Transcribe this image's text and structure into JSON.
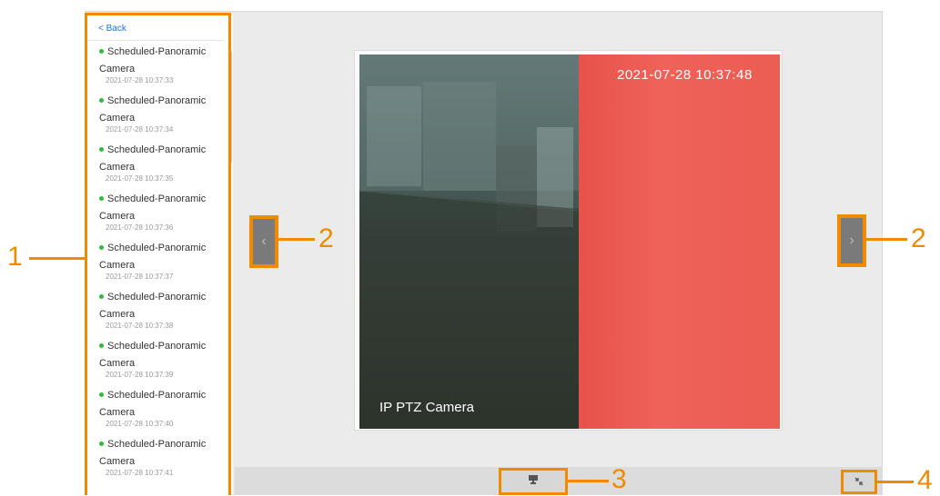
{
  "sidebar": {
    "back_label": "< Back",
    "items": [
      {
        "title": "Scheduled-Panoramic",
        "subtitle": "Camera",
        "time": "2021-07-28 10:37:33"
      },
      {
        "title": "Scheduled-Panoramic",
        "subtitle": "Camera",
        "time": "2021-07-28 10:37:34"
      },
      {
        "title": "Scheduled-Panoramic",
        "subtitle": "Camera",
        "time": "2021-07-28 10:37:35"
      },
      {
        "title": "Scheduled-Panoramic",
        "subtitle": "Camera",
        "time": "2021-07-28 10:37:36"
      },
      {
        "title": "Scheduled-Panoramic",
        "subtitle": "Camera",
        "time": "2021-07-28 10:37:37"
      },
      {
        "title": "Scheduled-Panoramic",
        "subtitle": "Camera",
        "time": "2021-07-28 10:37:38"
      },
      {
        "title": "Scheduled-Panoramic",
        "subtitle": "Camera",
        "time": "2021-07-28 10:37:39"
      },
      {
        "title": "Scheduled-Panoramic",
        "subtitle": "Camera",
        "time": "2021-07-28 10:37:40"
      },
      {
        "title": "Scheduled-Panoramic",
        "subtitle": "Camera",
        "time": "2021-07-28 10:37:41"
      }
    ],
    "status_color": "#2dbd3a"
  },
  "viewer": {
    "timestamp": "2021-07-28 10:37:48",
    "camera_label": "IP PTZ Camera",
    "prev_icon": "chevron-left-icon",
    "next_icon": "chevron-right-icon"
  },
  "toolbar": {
    "view_icon": "monitor-icon",
    "fullscreen_icon": "exit-fullscreen-icon"
  },
  "callouts": {
    "list": "1",
    "nav_left": "2",
    "nav_right": "2",
    "view": "3",
    "fullscreen": "4",
    "accent_color": "#f08a00"
  }
}
